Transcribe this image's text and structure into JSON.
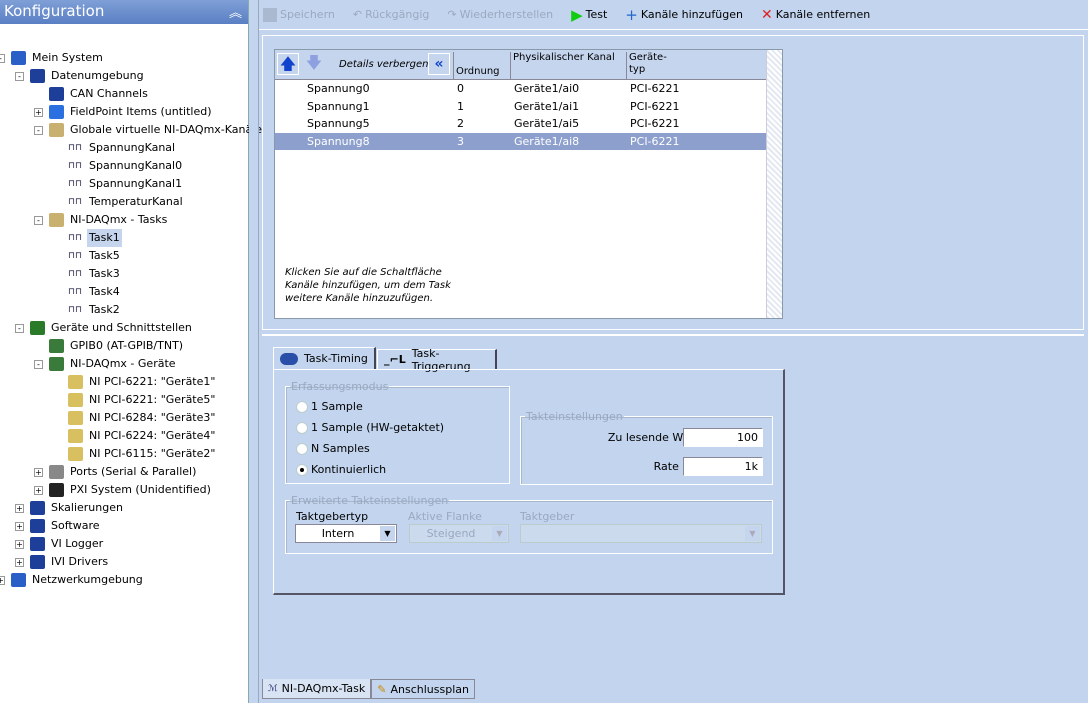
{
  "sidebar": {
    "title": "Konfiguration",
    "tree": [
      {
        "label": "Mein System",
        "level": 0,
        "exp": "-",
        "icon": "system-icon"
      },
      {
        "label": "Datenumgebung",
        "level": 1,
        "exp": "-",
        "icon": "folder-icon"
      },
      {
        "label": "CAN Channels",
        "level": 2,
        "exp": "",
        "icon": "folder-icon"
      },
      {
        "label": "FieldPoint Items (untitled)",
        "level": 2,
        "exp": "+",
        "icon": "fieldpoint-icon"
      },
      {
        "label": "Globale virtuelle NI-DAQmx-Kanäle",
        "level": 2,
        "exp": "-",
        "icon": "channels-folder-icon"
      },
      {
        "label": "SpannungKanal",
        "level": 3,
        "exp": "",
        "icon": "channel-icon"
      },
      {
        "label": "SpannungKanal0",
        "level": 3,
        "exp": "",
        "icon": "channel-icon"
      },
      {
        "label": "SpannungKanal1",
        "level": 3,
        "exp": "",
        "icon": "channel-icon"
      },
      {
        "label": "TemperaturKanal",
        "level": 3,
        "exp": "",
        "icon": "channel-icon"
      },
      {
        "label": "NI-DAQmx - Tasks",
        "level": 2,
        "exp": "-",
        "icon": "tasks-folder-icon"
      },
      {
        "label": "Task1",
        "level": 3,
        "exp": "",
        "icon": "task-icon",
        "selected": true
      },
      {
        "label": "Task5",
        "level": 3,
        "exp": "",
        "icon": "task-icon"
      },
      {
        "label": "Task3",
        "level": 3,
        "exp": "",
        "icon": "task-icon"
      },
      {
        "label": "Task4",
        "level": 3,
        "exp": "",
        "icon": "task-icon"
      },
      {
        "label": "Task2",
        "level": 3,
        "exp": "",
        "icon": "task-icon"
      },
      {
        "label": "Geräte und Schnittstellen",
        "level": 1,
        "exp": "-",
        "icon": "devices-icon"
      },
      {
        "label": "GPIB0 (AT-GPIB/TNT)",
        "level": 2,
        "exp": "",
        "icon": "gpib-icon"
      },
      {
        "label": "NI-DAQmx - Geräte",
        "level": 2,
        "exp": "-",
        "icon": "daq-devices-icon"
      },
      {
        "label": "NI PCI-6221: \"Geräte1\"",
        "level": 3,
        "exp": "",
        "icon": "device-icon"
      },
      {
        "label": "NI PCI-6221: \"Geräte5\"",
        "level": 3,
        "exp": "",
        "icon": "device-icon"
      },
      {
        "label": "NI PCI-6284: \"Geräte3\"",
        "level": 3,
        "exp": "",
        "icon": "device-icon"
      },
      {
        "label": "NI PCI-6224: \"Geräte4\"",
        "level": 3,
        "exp": "",
        "icon": "device-icon"
      },
      {
        "label": "NI PCI-6115: \"Geräte2\"",
        "level": 3,
        "exp": "",
        "icon": "device-icon"
      },
      {
        "label": "Ports (Serial & Parallel)",
        "level": 2,
        "exp": "+",
        "icon": "ports-icon"
      },
      {
        "label": "PXI System (Unidentified)",
        "level": 2,
        "exp": "+",
        "icon": "pxi-icon"
      },
      {
        "label": "Skalierungen",
        "level": 1,
        "exp": "+",
        "icon": "scales-icon"
      },
      {
        "label": "Software",
        "level": 1,
        "exp": "+",
        "icon": "software-icon"
      },
      {
        "label": "VI Logger",
        "level": 1,
        "exp": "+",
        "icon": "vilogger-icon"
      },
      {
        "label": "IVI Drivers",
        "level": 1,
        "exp": "+",
        "icon": "ivi-icon"
      },
      {
        "label": "Netzwerkumgebung",
        "level": 0,
        "exp": "+",
        "icon": "network-icon"
      }
    ]
  },
  "toolbar": {
    "save": "Speichern",
    "undo": "Rückgängig",
    "redo": "Wiederherstellen",
    "test": "Test",
    "add": "Kanäle hinzufügen",
    "remove": "Kanäle entfernen"
  },
  "grid": {
    "hide_details": "Details verbergen",
    "columns": [
      "Ordnung",
      "Physikalischer Kanal",
      "Geräte-typ"
    ],
    "rows": [
      [
        "Spannung0",
        "0",
        "Geräte1/ai0",
        "PCI-6221"
      ],
      [
        "Spannung1",
        "1",
        "Geräte1/ai1",
        "PCI-6221"
      ],
      [
        "Spannung5",
        "2",
        "Geräte1/ai5",
        "PCI-6221"
      ],
      [
        "Spannung8",
        "3",
        "Geräte1/ai8",
        "PCI-6221"
      ]
    ],
    "selected_row": 3,
    "hint": "Klicken Sie auf die Schaltfläche Kanäle hinzufügen, um dem Task weitere Kanäle hinzuzufügen."
  },
  "tabs": {
    "timing": "Task-Timing",
    "trigger": "Task-Triggerung"
  },
  "timing": {
    "mode_legend": "Erfassungsmodus",
    "modes": [
      "1 Sample",
      "1 Sample (HW-getaktet)",
      "N Samples",
      "Kontinuierlich"
    ],
    "selected_mode": 3,
    "clock_legend": "Takteinstellungen",
    "samples_label": "Zu lesende Werte",
    "samples_value": "100",
    "rate_label": "Rate (Hz)",
    "rate_value": "1k",
    "adv_legend": "Erweiterte Takteinstellungen",
    "clock_type_label": "Taktgebertyp",
    "clock_type_value": "Intern",
    "edge_label": "Aktive Flanke",
    "edge_value": "Steigend",
    "source_label": "Taktgeber",
    "source_value": ""
  },
  "bottom_tabs": [
    "NI-DAQmx-Task",
    "Anschlussplan"
  ]
}
